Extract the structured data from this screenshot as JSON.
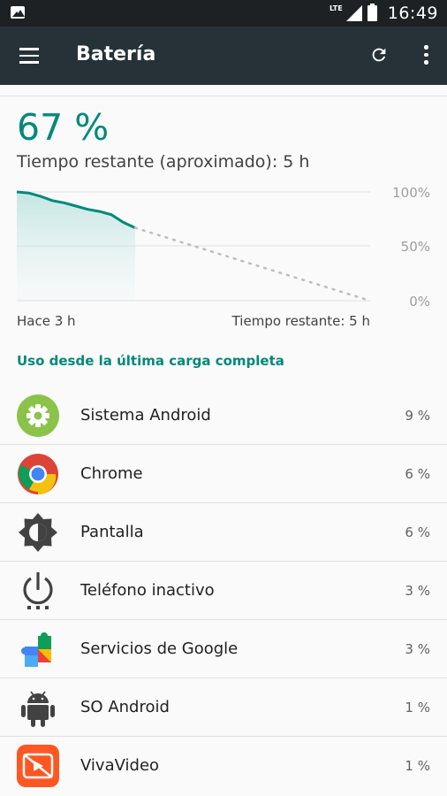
{
  "status_bar": {
    "network": "LTE",
    "time": "16:49"
  },
  "app_bar": {
    "title": "Batería",
    "icons": [
      "menu-icon",
      "refresh-icon",
      "more-vert-icon"
    ]
  },
  "summary": {
    "percent": "67 %",
    "remaining_text": "Tiempo restante (aproximado): 5 h"
  },
  "chart_data": {
    "type": "line",
    "title": "",
    "y_ticks": [
      "100%",
      "50%",
      "0%"
    ],
    "x_start_label": "Hace 3 h",
    "x_end_label": "Tiempo restante: 5 h",
    "ylim": [
      0,
      100
    ],
    "series": [
      {
        "values": [
          100,
          99,
          96,
          92,
          90,
          87,
          84,
          82,
          79,
          72,
          67
        ]
      }
    ],
    "projection": [
      67,
      0
    ],
    "colors": {
      "line": "#00897b",
      "fill": "#b2dfdb",
      "projection": "#bdbdbd"
    }
  },
  "usage": {
    "heading": "Uso desde la última carga completa",
    "items": [
      {
        "name": "Sistema Android",
        "value": "9 %",
        "icon": "android-system-gear-icon"
      },
      {
        "name": "Chrome",
        "value": "6 %",
        "icon": "chrome-icon"
      },
      {
        "name": "Pantalla",
        "value": "6 %",
        "icon": "brightness-icon"
      },
      {
        "name": "Teléfono inactivo",
        "value": "3 %",
        "icon": "power-icon"
      },
      {
        "name": "Servicios de Google",
        "value": "3 %",
        "icon": "google-play-services-icon"
      },
      {
        "name": "SO Android",
        "value": "1 %",
        "icon": "android-robot-icon"
      },
      {
        "name": "VivaVideo",
        "value": "1 %",
        "icon": "vivavideo-icon"
      }
    ]
  },
  "colors": {
    "accent": "#00897b",
    "appbar": "#263238",
    "statusbar": "#1e2124"
  }
}
